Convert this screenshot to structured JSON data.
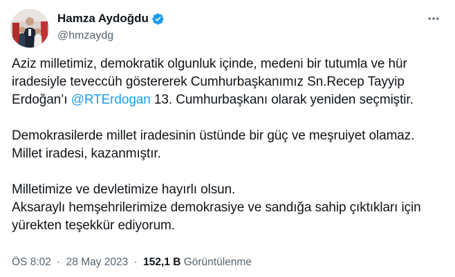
{
  "author": {
    "display_name": "Hamza Aydoğdu",
    "handle": "@hmzaydg",
    "verified": true,
    "avatar": "profile-photo",
    "accent_color": "#1d9bf0"
  },
  "tweet": {
    "paragraph1": {
      "before_mention": "Aziz milletimiz, demokratik olgunluk içinde, medeni bir tutumla ve hür iradesiyle teveccüh göstererek Cumhurbaşkanımız Sn.Recep Tayyip Erdoğan’ı ",
      "mention": "@RTErdogan",
      "after_mention": " 13. Cumhurbaşkanı olarak yeniden seçmiştir."
    },
    "paragraph2_line1": "Demokrasilerde millet iradesinin üstünde bir güç ve meşruiyet olamaz.",
    "paragraph2_line2": "Millet iradesi, kazanmıştır.",
    "paragraph3_line1": "Milletimize ve devletimize hayırlı olsun.",
    "paragraph3_line2": "Aksaraylı hemşehrilerimize demokrasiye ve sandığa sahip çıktıkları için yürekten teşekkür ediyorum."
  },
  "meta": {
    "time": "ÖS 8:02",
    "separator": "·",
    "date": "28 May 2023",
    "views_count": "152,1 B",
    "views_label": "Görüntülenme"
  },
  "icons": {
    "verified": "verified-badge-icon",
    "more": "more-options-icon"
  }
}
